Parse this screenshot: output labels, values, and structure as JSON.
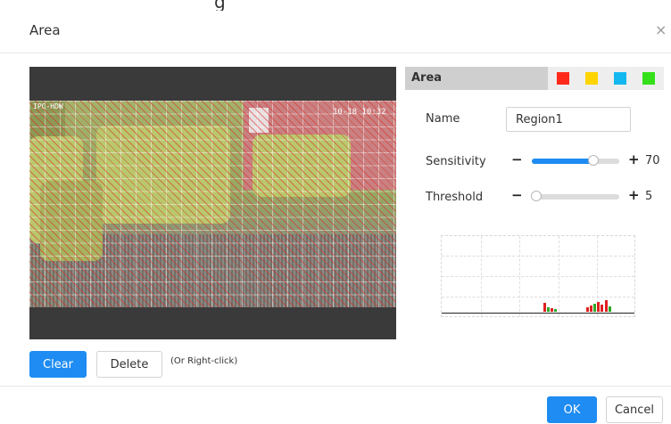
{
  "dialog": {
    "title": "Area",
    "close_glyph": "×",
    "top_partial_text": "g"
  },
  "video": {
    "osd_time": "10-18 10:32",
    "osd_left": "IPC-HDW"
  },
  "buttons": {
    "clear": "Clear",
    "delete": "Delete",
    "hint": "(Or Right-click)",
    "ok": "OK",
    "cancel": "Cancel"
  },
  "area_panel": {
    "header_label": "Area",
    "swatches": [
      {
        "name": "red",
        "color": "#ff2a1a"
      },
      {
        "name": "yellow",
        "color": "#ffd400"
      },
      {
        "name": "cyan",
        "color": "#14b8f0"
      },
      {
        "name": "green",
        "color": "#33e019"
      }
    ],
    "name_label": "Name",
    "name_value": "Region1",
    "sensitivity_label": "Sensitivity",
    "sensitivity_value": "70",
    "sensitivity_fraction": 0.7,
    "threshold_label": "Threshold",
    "threshold_value": "5",
    "threshold_fraction": 0.05,
    "minus_glyph": "−",
    "plus_glyph": "+"
  },
  "colors": {
    "accent": "#1e8cf2",
    "graph_red": "#e02020",
    "graph_green": "#2aa82a"
  }
}
